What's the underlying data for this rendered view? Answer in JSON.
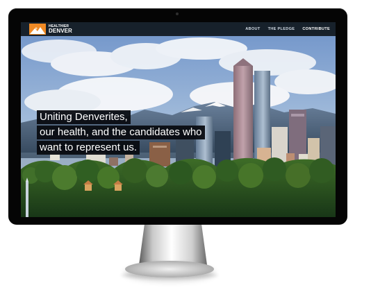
{
  "brand": {
    "line_1": "HEALTHIER",
    "line_2": "DENVER",
    "logo_icon": "mountain-logo-icon",
    "accent_colors": [
      "#f08a24",
      "#ffffff",
      "#1f2a35"
    ]
  },
  "navigation": {
    "items": [
      {
        "label": "ABOUT"
      },
      {
        "label": "THE PLEDGE"
      },
      {
        "label": "CONTRIBUTE"
      }
    ]
  },
  "hero": {
    "headline_lines": [
      "Uniting Denverites,",
      "our health, and the candidates who",
      "want to represent us."
    ]
  },
  "device": {
    "apple_icon": "apple-logo-icon"
  }
}
